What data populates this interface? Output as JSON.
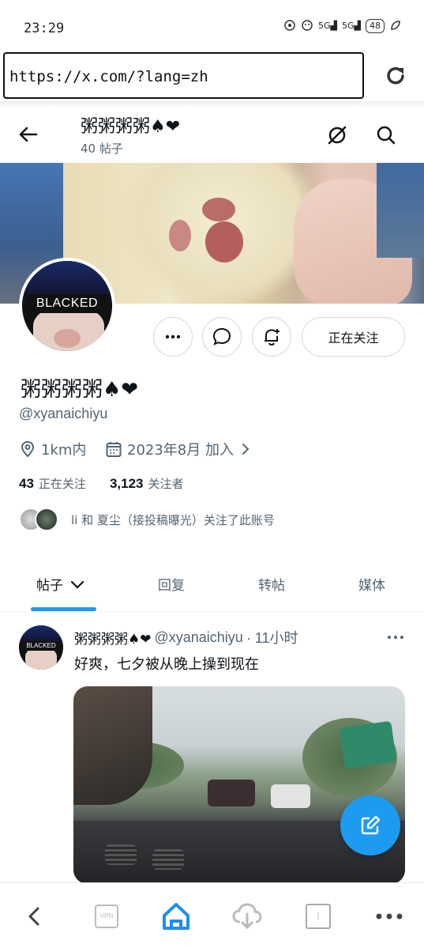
{
  "status_bar": {
    "time": "23:29",
    "network": "5G",
    "network2": "5G",
    "battery": "48"
  },
  "browser": {
    "url": "https://x.com/?lang=zh"
  },
  "header": {
    "name": "粥粥粥粥♠❤",
    "post_count": "40 帖子"
  },
  "profile": {
    "avatar_text": "BLACKED",
    "name": "粥粥粥粥♠❤",
    "handle": "@xyanaichiyu",
    "location": "1km内",
    "joined": "2023年8月 加入",
    "following_count": "43",
    "following_label": "正在关注",
    "followers_count": "3,123",
    "followers_label": "关注者",
    "followed_by": "li 和 夏尘（接投稿曝光）关注了此账号",
    "follow_button": "正在关注"
  },
  "tabs": [
    {
      "label": "帖子"
    },
    {
      "label": "回复"
    },
    {
      "label": "转帖"
    },
    {
      "label": "媒体"
    }
  ],
  "post": {
    "avatar_text": "BLACKED",
    "name": "粥粥粥粥♠❤",
    "handle": "@xyanaichiyu",
    "time": "· 11小时",
    "text": "好爽，七夕被从晚上操到现在"
  },
  "colors": {
    "accent": "#1d9bf0",
    "text_primary": "#0f1419",
    "text_secondary": "#536471",
    "border": "#cfd9de"
  }
}
